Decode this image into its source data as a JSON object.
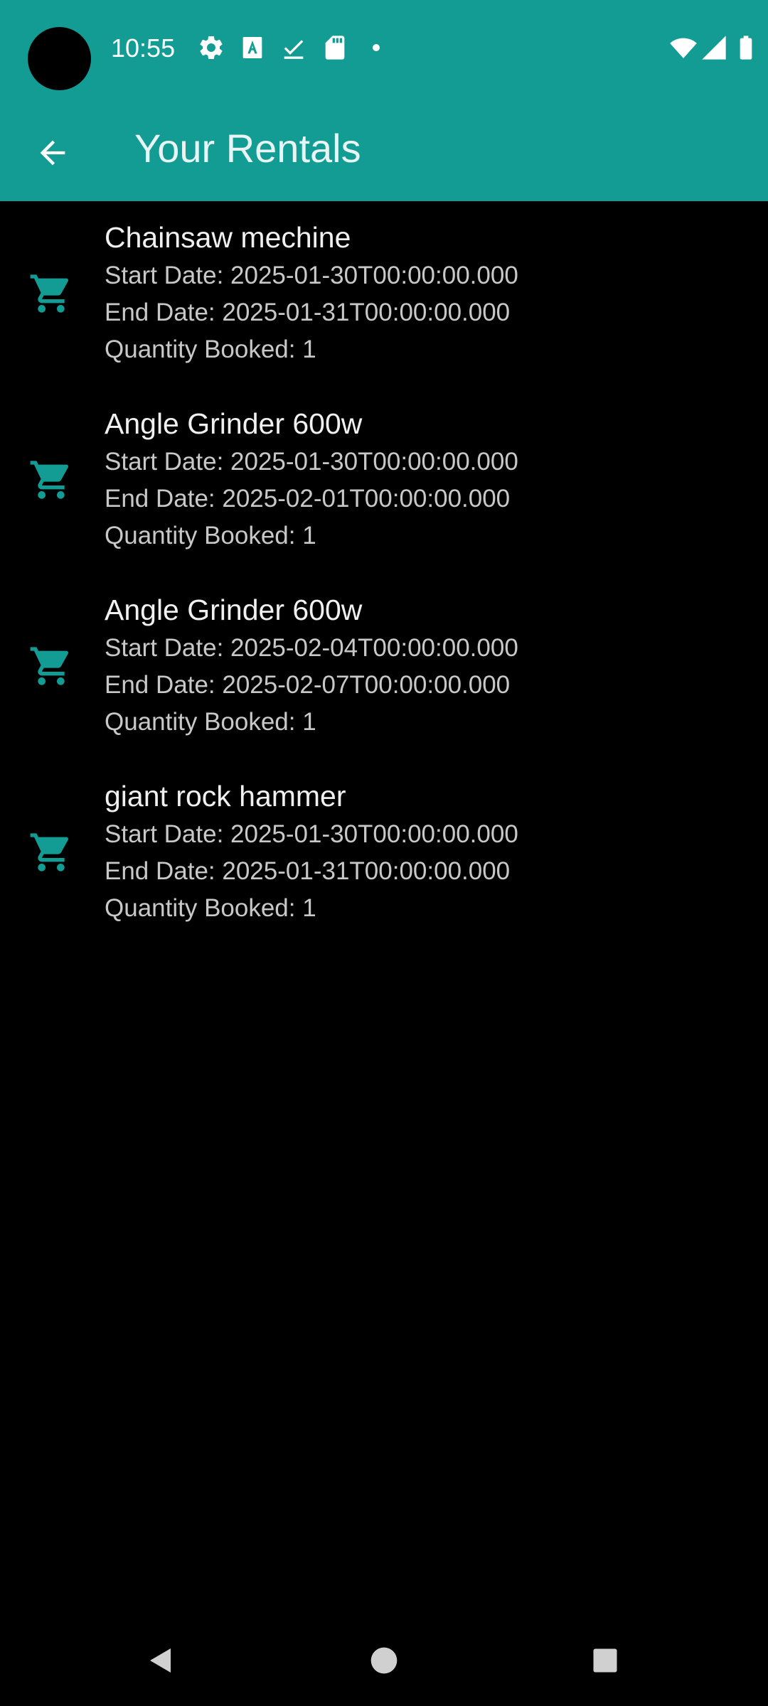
{
  "status_bar": {
    "time": "10:55",
    "icons": [
      "gear-icon",
      "text-a-icon",
      "download-done-icon",
      "sd-card-icon",
      "dot-icon",
      "wifi-icon",
      "signal-icon",
      "battery-icon"
    ]
  },
  "app_bar": {
    "back_icon": "arrow-back-icon",
    "title": "Your Rentals"
  },
  "rentals": [
    {
      "name": "Chainsaw mechine",
      "start": "Start Date: 2025-01-30T00:00:00.000",
      "end": "End Date: 2025-01-31T00:00:00.000",
      "quantity": "Quantity Booked: 1",
      "icon": "shopping-cart-icon"
    },
    {
      "name": "Angle Grinder 600w",
      "start": "Start Date: 2025-01-30T00:00:00.000",
      "end": "End Date: 2025-02-01T00:00:00.000",
      "quantity": "Quantity Booked: 1",
      "icon": "shopping-cart-icon"
    },
    {
      "name": "Angle Grinder 600w",
      "start": "Start Date: 2025-02-04T00:00:00.000",
      "end": "End Date: 2025-02-07T00:00:00.000",
      "quantity": "Quantity Booked: 1",
      "icon": "shopping-cart-icon"
    },
    {
      "name": "giant rock hammer",
      "start": "Start Date: 2025-01-30T00:00:00.000",
      "end": "End Date: 2025-01-31T00:00:00.000",
      "quantity": "Quantity Booked: 1",
      "icon": "shopping-cart-icon"
    }
  ],
  "nav_bar": {
    "icons": [
      "nav-back-icon",
      "nav-home-icon",
      "nav-recents-icon"
    ]
  },
  "colors": {
    "accent": "#139c94",
    "background": "#000000",
    "cart_icon": "#139c94",
    "title_text": "#e9f5f4",
    "primary_text": "#f0f0f0",
    "secondary_text": "#c8c8c8",
    "nav_icons": "#d0d0d0"
  }
}
